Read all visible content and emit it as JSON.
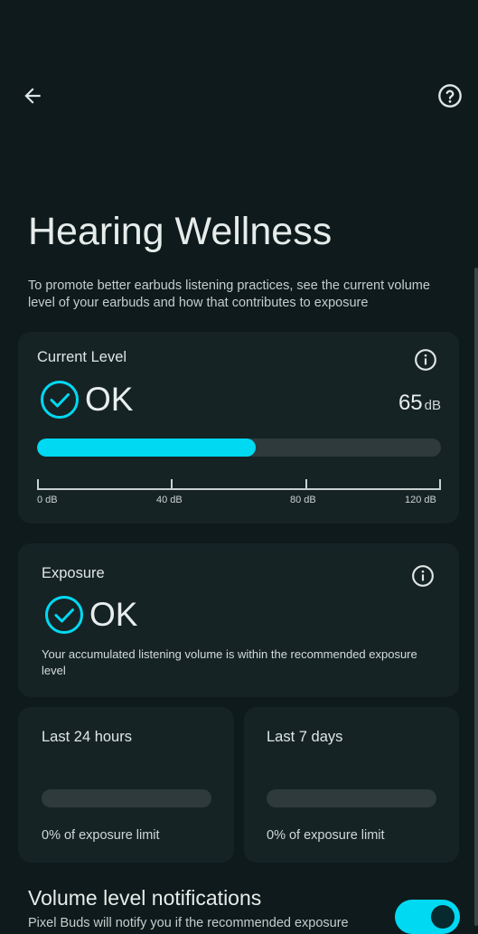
{
  "header": {
    "back_icon": "arrow-back-icon",
    "help_icon": "help-circle-icon"
  },
  "page": {
    "title": "Hearing Wellness",
    "description": "To promote better earbuds listening practices, see the current volume level of your earbuds and how that contributes to exposure"
  },
  "current_level": {
    "label": "Current Level",
    "status": "OK",
    "value": "65",
    "unit": "dB",
    "level_fraction": 0.542,
    "scale_labels": [
      "0 dB",
      "40 dB",
      "80 dB",
      "120 dB"
    ],
    "info_icon": "info-icon",
    "status_icon": "check-circle-icon"
  },
  "exposure": {
    "label": "Exposure",
    "status": "OK",
    "description": "Your accumulated listening volume is within the recommended exposure level",
    "info_icon": "info-icon",
    "status_icon": "check-circle-icon"
  },
  "last_24h": {
    "label": "Last 24 hours",
    "caption": "0% of exposure limit",
    "fraction": 0
  },
  "last_7d": {
    "label": "Last 7 days",
    "caption": "0% of exposure limit",
    "fraction": 0
  },
  "notifications": {
    "title": "Volume level notifications",
    "description": "Pixel Buds will notify you if the recommended exposure",
    "enabled": true
  },
  "colors": {
    "accent": "#00d9f2",
    "background": "#0e1a1b",
    "card": "#162325",
    "track": "#2e3a3c"
  }
}
